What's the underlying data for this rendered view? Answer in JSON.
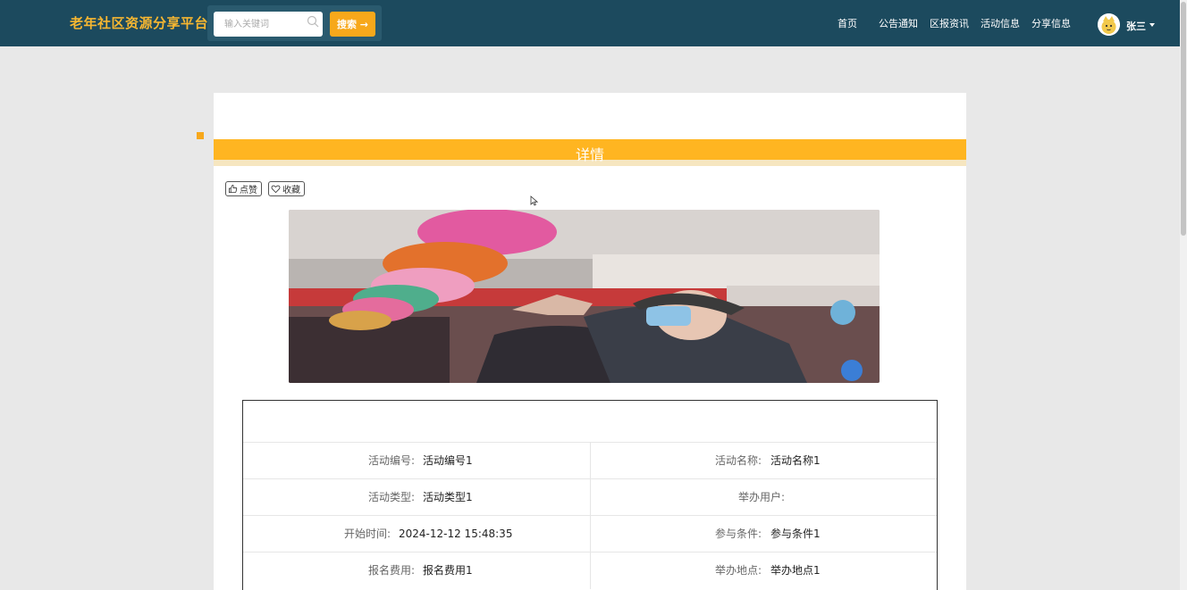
{
  "app": {
    "brand": "老年社区资源分享平台"
  },
  "search": {
    "placeholder": "输入关键词",
    "button_label": "搜索 →"
  },
  "nav": {
    "items": [
      "首页",
      "公告通知",
      "区报资讯",
      "活动信息",
      "分享信息"
    ]
  },
  "user": {
    "name": "张三"
  },
  "detail": {
    "title": "详情",
    "like_label": "点赞",
    "favorite_label": "收藏"
  },
  "fields": [
    {
      "label": "活动编号:",
      "value": "活动编号1"
    },
    {
      "label": "活动名称:",
      "value": "活动名称1"
    },
    {
      "label": "活动类型:",
      "value": "活动类型1"
    },
    {
      "label": "举办用户:",
      "value": ""
    },
    {
      "label": "开始时间:",
      "value": "2024-12-12 15:48:35"
    },
    {
      "label": "参与条件:",
      "value": "参与条件1"
    },
    {
      "label": "报名费用:",
      "value": "报名费用1"
    },
    {
      "label": "举办地点:",
      "value": "举办地点1"
    }
  ],
  "colors": {
    "header": "#1c4a5e",
    "accent": "#ffb521",
    "brand": "#f7b731"
  }
}
